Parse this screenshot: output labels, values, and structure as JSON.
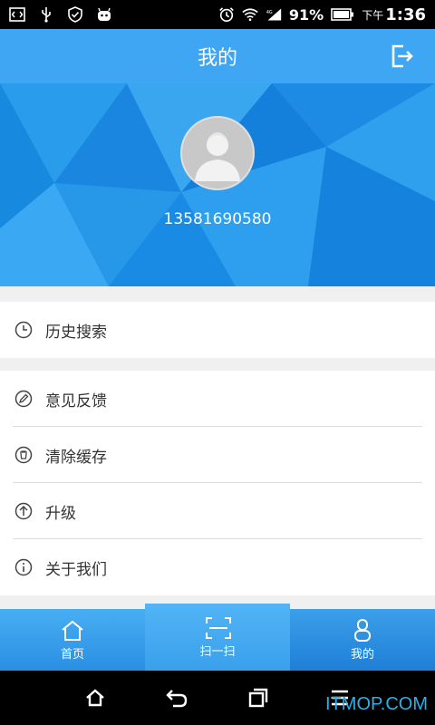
{
  "status_bar": {
    "battery": "91%",
    "ampm": "下午",
    "time": "1:36",
    "icons": [
      "code-icon",
      "usb-icon",
      "shield-icon",
      "android-icon",
      "alarm-icon",
      "wifi-icon",
      "signal-icon",
      "battery-icon"
    ]
  },
  "header": {
    "title": "我的"
  },
  "profile": {
    "phone": "13581690580"
  },
  "menu": {
    "group1": [
      {
        "label": "历史搜索",
        "icon": "clock-icon"
      }
    ],
    "group2": [
      {
        "label": "意见反馈",
        "icon": "pencil-icon"
      },
      {
        "label": "清除缓存",
        "icon": "trash-icon"
      },
      {
        "label": "升级",
        "icon": "arrow-up-icon"
      },
      {
        "label": "关于我们",
        "icon": "info-icon"
      }
    ]
  },
  "tabs": [
    {
      "label": "首页",
      "icon": "home-icon"
    },
    {
      "label": "扫一扫",
      "icon": "scan-icon"
    },
    {
      "label": "我的",
      "icon": "person-icon"
    }
  ],
  "watermark": "ITMOP.COM",
  "colors": {
    "header": "#3ea6f2",
    "banner": "#1c8fe6",
    "tabbar": "#2a8fe2",
    "watermark": "#2ab0e8"
  }
}
